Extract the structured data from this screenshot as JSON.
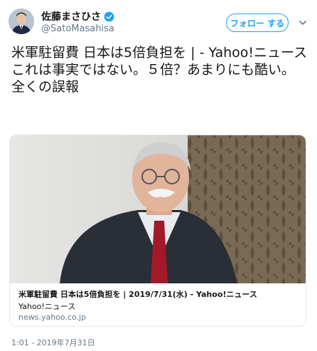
{
  "author": {
    "name": "佐藤まさひさ",
    "handle": "@SatoMasahisa",
    "avatar_icon": "profile-photo",
    "verified_icon": "verified-badge-icon"
  },
  "follow_button": {
    "label": "フォロー する"
  },
  "tweet": {
    "lines": [
      "米軍駐留費 日本は5倍負担を | - Yahoo!ニュース",
      "これは事実ではない。５倍？あまりにも酷い。",
      "全くの誤報"
    ]
  },
  "link_card": {
    "title": "米軍駐留費 日本は5倍負担を | 2019/7/31(水) - Yahoo!ニュース",
    "description": "Yahoo!ニュース",
    "domain": "news.yahoo.co.jp"
  },
  "timestamp": "1:01 - 2019年7月31日",
  "colors": {
    "accent": "#1da1f2",
    "secondary_text": "#657786",
    "border": "#e1e8ed"
  }
}
